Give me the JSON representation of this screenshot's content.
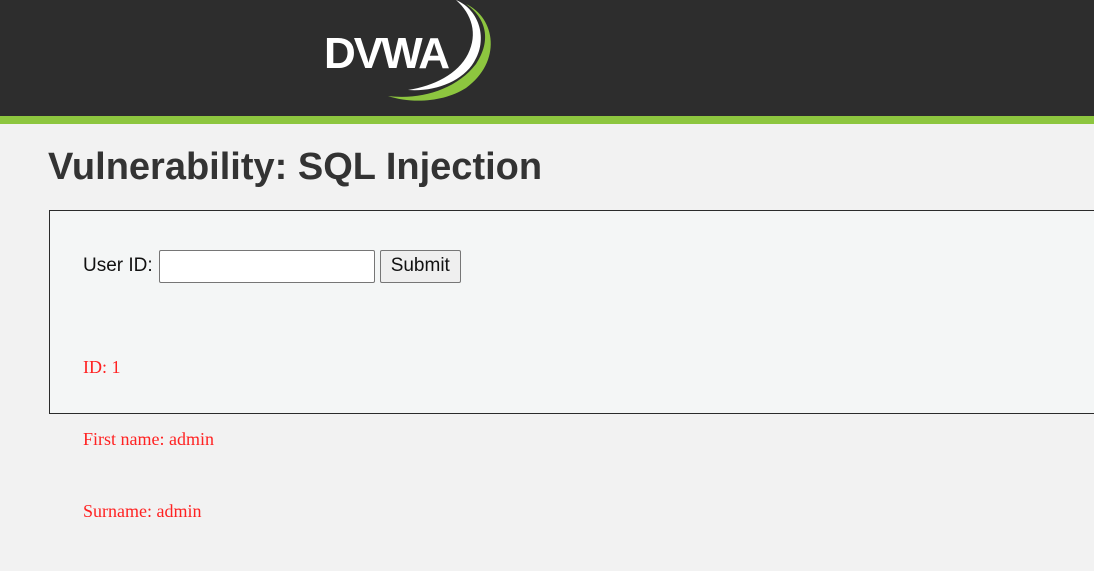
{
  "header": {
    "logo_text": "DVWA",
    "colors": {
      "background": "#2d2d2d",
      "accent": "#8dc63f"
    }
  },
  "page": {
    "title": "Vulnerability: SQL Injection"
  },
  "form": {
    "user_id_label": "User ID:",
    "user_id_value": "",
    "submit_label": "Submit"
  },
  "result": {
    "color": "#ff2222",
    "lines": [
      "ID: 1",
      "First name: admin",
      "Surname: admin"
    ]
  }
}
